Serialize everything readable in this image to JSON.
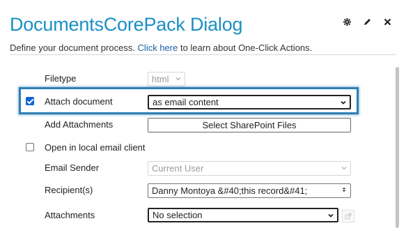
{
  "dialog": {
    "title": "DocumentsCorePack Dialog",
    "subtitle_prefix": "Define your document process. ",
    "subtitle_link": "Click here",
    "subtitle_suffix": " to learn about One-Click Actions."
  },
  "window_icons": [
    "gear-icon",
    "edit-icon",
    "close-icon"
  ],
  "form": {
    "filetype": {
      "label": "Filetype",
      "value": "html"
    },
    "attach_document": {
      "label": "Attach document",
      "checked": true,
      "value": "as email content"
    },
    "add_attachments": {
      "label": "Add Attachments",
      "button": "Select SharePoint Files"
    },
    "open_local": {
      "label": "Open in local email client",
      "checked": false
    },
    "email_sender": {
      "label": "Email Sender",
      "value": "Current User"
    },
    "recipients": {
      "label": "Recipient(s)",
      "value": "Danny Montoya &#40;this record&#41;"
    },
    "attachments": {
      "label": "Attachments",
      "value": "No selection"
    }
  },
  "colors": {
    "title": "#1a8fc4",
    "highlight": "#2f7fb6",
    "checkbox": "#0b64d8"
  }
}
